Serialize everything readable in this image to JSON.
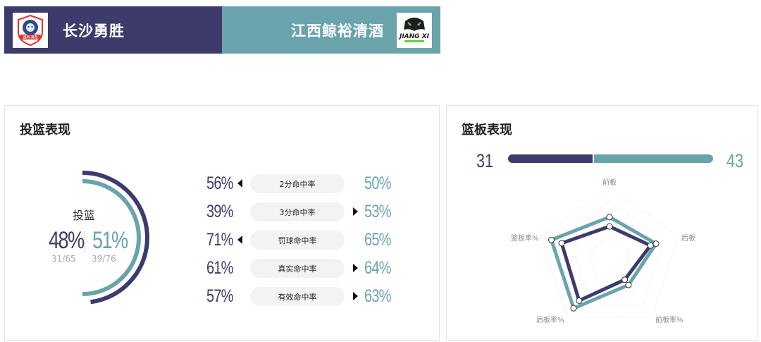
{
  "header": {
    "home_team": "长沙勇胜",
    "away_team": "江西鲸裕清酒",
    "home_logo_icon": "lion-shield-logo-icon",
    "away_logo_icon": "panther-jiangxi-logo-icon",
    "home_logo_text": "湖南·勇胜",
    "away_logo_text": "JIANG XI"
  },
  "colors": {
    "home": "#3d3b6b",
    "away": "#6aa3ac"
  },
  "shooting": {
    "title": "投篮表现",
    "donut": {
      "label": "投篮",
      "home_pct": "48%",
      "away_pct": "51%",
      "home_made": "31/65",
      "away_made": "39/76",
      "home_value": 0.48,
      "away_value": 0.51
    },
    "rows": [
      {
        "label": "2分命中率",
        "home": "56%",
        "away": "50%",
        "leader": "home"
      },
      {
        "label": "3分命中率",
        "home": "39%",
        "away": "53%",
        "leader": "away"
      },
      {
        "label": "罚球命中率",
        "home": "71%",
        "away": "65%",
        "leader": "home"
      },
      {
        "label": "真实命中率",
        "home": "61%",
        "away": "64%",
        "leader": "away"
      },
      {
        "label": "有效命中率",
        "home": "57%",
        "away": "63%",
        "leader": "away"
      }
    ]
  },
  "rebounds": {
    "title": "篮板表现",
    "home_total": "31",
    "away_total": "43",
    "home_value": 31,
    "away_value": 43,
    "radar": {
      "axes": [
        "前板",
        "后板",
        "前板率%",
        "后板率%",
        "篮板率%"
      ],
      "home": [
        0.45,
        0.6,
        0.36,
        0.72,
        0.7
      ],
      "away": [
        0.58,
        0.68,
        0.45,
        0.85,
        0.85
      ]
    }
  }
}
